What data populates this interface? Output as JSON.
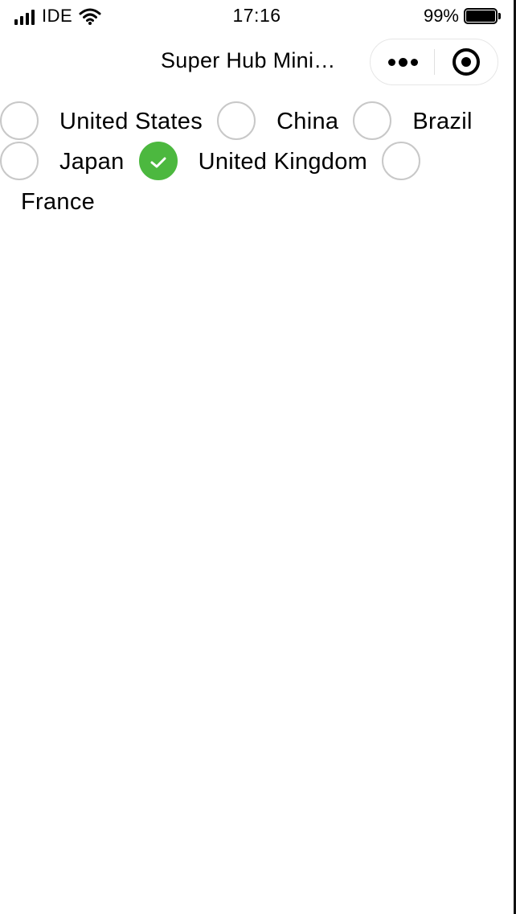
{
  "status_bar": {
    "carrier": "IDE",
    "time": "17:16",
    "battery_percent_text": "99%",
    "battery_level": 0.99,
    "icons": [
      "signal-icon",
      "wifi-icon",
      "battery-icon"
    ]
  },
  "nav": {
    "title": "Super Hub Mini…",
    "more_icon": "more-dots-icon",
    "close_icon": "target-icon"
  },
  "radio_group": {
    "accent_color": "#4cb83f",
    "items": [
      {
        "label": "United States",
        "checked": false
      },
      {
        "label": "China",
        "checked": false
      },
      {
        "label": "Brazil",
        "checked": false
      },
      {
        "label": "Japan",
        "checked": false
      },
      {
        "label": "United Kingdom",
        "checked": true
      },
      {
        "label": "France",
        "checked": false
      }
    ]
  }
}
